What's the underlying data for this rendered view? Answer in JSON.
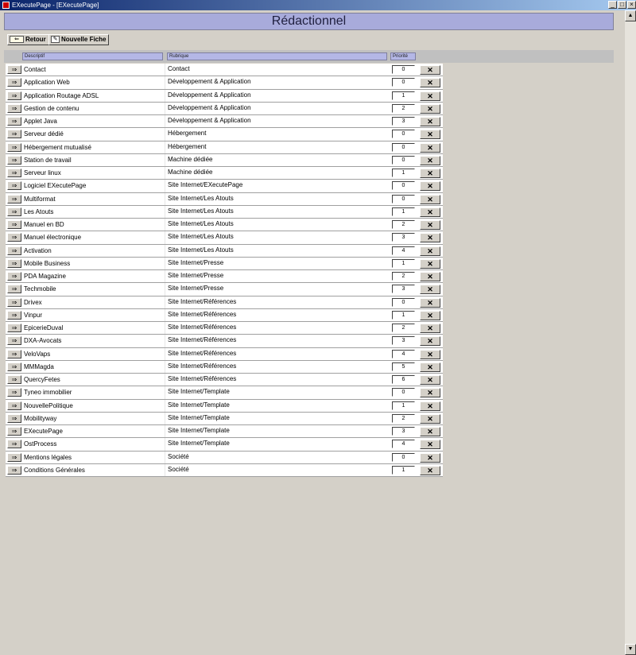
{
  "window": {
    "title": "EXecutePage - [EXecutePage]",
    "controls": [
      "_",
      "□",
      "×"
    ]
  },
  "page": {
    "title": "Rédactionnel"
  },
  "toolbar": {
    "retour_label": "Retour",
    "nouvelle_fiche_label": "Nouvelle Fiche"
  },
  "columns": {
    "descriptif": "Descriptif",
    "rubrique": "Rubrique",
    "priorite": "Priorité"
  },
  "icons": {
    "nav": "edit-arrow-icon",
    "delete": "delete-x-icon"
  },
  "rows": [
    {
      "descriptif": "Contact",
      "rubrique": "Contact",
      "priorite": "0"
    },
    {
      "descriptif": "Application Web",
      "rubrique": "Développement & Application",
      "priorite": "0"
    },
    {
      "descriptif": "Application Routage ADSL",
      "rubrique": "Développement & Application",
      "priorite": "1"
    },
    {
      "descriptif": "Gestion de contenu",
      "rubrique": "Développement & Application",
      "priorite": "2"
    },
    {
      "descriptif": "Applet Java",
      "rubrique": "Développement & Application",
      "priorite": "3"
    },
    {
      "descriptif": "Serveur dédié",
      "rubrique": "Hébergement",
      "priorite": "0"
    },
    {
      "descriptif": "Hébergement mutualisé",
      "rubrique": "Hébergement",
      "priorite": "0"
    },
    {
      "descriptif": "Station de travail",
      "rubrique": "Machine dédiée",
      "priorite": "0"
    },
    {
      "descriptif": "Serveur linux",
      "rubrique": "Machine dédiée",
      "priorite": "1"
    },
    {
      "descriptif": "Logiciel EXecutePage",
      "rubrique": "Site Internet/EXecutePage",
      "priorite": "0"
    },
    {
      "descriptif": "Multiformat",
      "rubrique": "Site Internet/Les Atouts",
      "priorite": "0"
    },
    {
      "descriptif": "Les Atouts",
      "rubrique": "Site Internet/Les Atouts",
      "priorite": "1"
    },
    {
      "descriptif": "Manuel en BD",
      "rubrique": "Site Internet/Les Atouts",
      "priorite": "2"
    },
    {
      "descriptif": "Manuel électronique",
      "rubrique": "Site Internet/Les Atouts",
      "priorite": "3"
    },
    {
      "descriptif": "Activation",
      "rubrique": "Site Internet/Les Atouts",
      "priorite": "4"
    },
    {
      "descriptif": "Mobile Business",
      "rubrique": "Site Internet/Presse",
      "priorite": "1"
    },
    {
      "descriptif": "PDA Magazine",
      "rubrique": "Site Internet/Presse",
      "priorite": "2"
    },
    {
      "descriptif": "Techmobile",
      "rubrique": "Site Internet/Presse",
      "priorite": "3"
    },
    {
      "descriptif": "Drivex",
      "rubrique": "Site Internet/Références",
      "priorite": "0"
    },
    {
      "descriptif": "Vinpur",
      "rubrique": "Site Internet/Références",
      "priorite": "1"
    },
    {
      "descriptif": "EpicerieDuval",
      "rubrique": "Site Internet/Références",
      "priorite": "2"
    },
    {
      "descriptif": "DXA-Avocats",
      "rubrique": "Site Internet/Références",
      "priorite": "3"
    },
    {
      "descriptif": "VeloVaps",
      "rubrique": "Site Internet/Références",
      "priorite": "4"
    },
    {
      "descriptif": "MMMagda",
      "rubrique": "Site Internet/Références",
      "priorite": "5"
    },
    {
      "descriptif": "QuercyFetes",
      "rubrique": "Site Internet/Références",
      "priorite": "6"
    },
    {
      "descriptif": "Tyneo immobilier",
      "rubrique": "Site Internet/Template",
      "priorite": "0"
    },
    {
      "descriptif": "NouvellePolitique",
      "rubrique": "Site Internet/Template",
      "priorite": "1"
    },
    {
      "descriptif": "Mobilityway",
      "rubrique": "Site Internet/Template",
      "priorite": "2"
    },
    {
      "descriptif": "EXecutePage",
      "rubrique": "Site Internet/Template",
      "priorite": "3"
    },
    {
      "descriptif": "OstProcess",
      "rubrique": "Site Internet/Template",
      "priorite": "4"
    },
    {
      "descriptif": "Mentions légales",
      "rubrique": "Société",
      "priorite": "0"
    },
    {
      "descriptif": "Conditions Générales",
      "rubrique": "Société",
      "priorite": "1"
    }
  ]
}
